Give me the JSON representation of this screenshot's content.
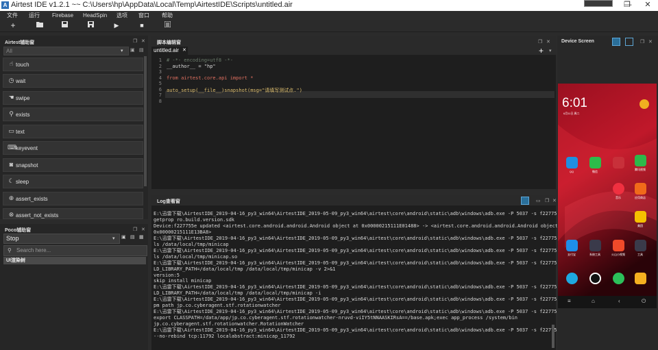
{
  "window": {
    "title": "Airtest IDE v1.2.1 ~~ C:\\Users\\hp\\AppData\\Local\\Temp\\AirtestIDE\\Scripts\\untitled.air",
    "logo": "A",
    "minimize": "—",
    "maximize": "❐",
    "close": "✕"
  },
  "menu": [
    "文件",
    "运行",
    "Firebase",
    "HeadSpin",
    "选项",
    "窗口",
    "帮助"
  ],
  "toolbar": {
    "new": "+",
    "open": "folder-icon",
    "save": "save-icon",
    "save_as": "save-as-icon",
    "run": "▶",
    "stop": "■",
    "report": "report-icon"
  },
  "airtest_panel": {
    "title": "Airtest辅助窗",
    "filter_value": "All",
    "buttons": [
      "touch",
      "wait",
      "swipe",
      "exists",
      "text",
      "keyevent",
      "snapshot",
      "sleep",
      "assert_exists",
      "assert_not_exists"
    ]
  },
  "poco_panel": {
    "title": "Poco辅助窗",
    "mode_value": "Stop",
    "search_placeholder": "Search here...",
    "tree_root": "UI渲染树"
  },
  "editor": {
    "title": "脚本编辑窗",
    "tab_label": "untitled.air",
    "tab_close": "✕",
    "add": "+",
    "line_numbers": [
      "1",
      "2",
      "3",
      "4",
      "5",
      "6",
      "7",
      "8"
    ],
    "lines": [
      "# -*- encoding=utf8 -*-",
      "__author__ = \"hp\"",
      "",
      "from airtest.core.api import *",
      "",
      "auto_setup(__file__)snapshot(msg=\"请填写测试点.\")",
      "",
      ""
    ]
  },
  "log": {
    "title": "Log查看窗",
    "lines": [
      "E:\\迅雷下载\\AirtestIDE_2019-04-16_py3_win64\\AirtestIDE_2019-05-09_py3_win64\\airtest\\core\\android\\static\\adb\\windows\\adb.exe -P 5037 -s f227755e shell",
      "getprop ro.build.version.sdk",
      "Device:f227755e updated <airtest.core.android.android.Android object at 0x00000215111E01488> -> <airtest.core.android.android.Android object at",
      "0x00000215111E13BA8>",
      "E:\\迅雷下载\\AirtestIDE_2019-04-16_py3_win64\\AirtestIDE_2019-05-09_py3_win64\\airtest\\core\\android\\static\\adb\\windows\\adb.exe -P 5037 -s f227755e shell",
      "ls /data/local/tmp/minicap",
      "E:\\迅雷下载\\AirtestIDE_2019-04-16_py3_win64\\AirtestIDE_2019-05-09_py3_win64\\airtest\\core\\android\\static\\adb\\windows\\adb.exe -P 5037 -s f227755e shell",
      "ls /data/local/tmp/minicap.so",
      "E:\\迅雷下载\\AirtestIDE_2019-04-16_py3_win64\\AirtestIDE_2019-05-09_py3_win64\\airtest\\core\\android\\static\\adb\\windows\\adb.exe -P 5037 -s f227755e shell",
      "LD_LIBRARY_PATH=/data/local/tmp /data/local/tmp/minicap -v 2>&1",
      "version:5",
      "skip install minicap",
      "E:\\迅雷下载\\AirtestIDE_2019-04-16_py3_win64\\AirtestIDE_2019-05-09_py3_win64\\airtest\\core\\android\\static\\adb\\windows\\adb.exe -P 5037 -s f227755e shell",
      "LD_LIBRARY_PATH=/data/local/tmp /data/local/tmp/minicap -i",
      "E:\\迅雷下载\\AirtestIDE_2019-04-16_py3_win64\\AirtestIDE_2019-05-09_py3_win64\\airtest\\core\\android\\static\\adb\\windows\\adb.exe -P 5037 -s f227755e shell",
      "pm path jp.co.cyberagent.stf.rotationwatcher",
      "E:\\迅雷下载\\AirtestIDE_2019-04-16_py3_win64\\AirtestIDE_2019-05-09_py3_win64\\airtest\\core\\android\\static\\adb\\windows\\adb.exe -P 5037 -s f227755e shell",
      "export CLASSPATH=/data/app/jp.co.cyberagent.stf.rotationwatcher-nruvd-viIY5tNNAASKIRsA==/base.apk;exec app_process /system/bin",
      "jp.co.cyberagent.stf.rotationwatcher.RotationWatcher",
      "E:\\迅雷下载\\AirtestIDE_2019-04-16_py3_win64\\AirtestIDE_2019-05-09_py3_win64\\airtest\\core\\android\\static\\adb\\windows\\adb.exe -P 5037 -s f227755e forward",
      "--no-rebind tcp:11792 localabstract:minicap_11792"
    ]
  },
  "device": {
    "title": "Device Screen",
    "clock": "6:01",
    "date": "6月11日 周二",
    "apps_row1": [
      "QQ",
      "微信",
      "",
      "",
      "腾讯视频"
    ],
    "apps_row2": [
      "",
      "",
      "",
      "音乐",
      "应用商店"
    ],
    "apps_row3": [
      "",
      "",
      "",
      "",
      "美团"
    ],
    "apps_row4": [
      "支付宝",
      "系统工具",
      "",
      "火山小视频",
      "工具"
    ],
    "dock": [
      "",
      "",
      "",
      ""
    ],
    "colors": {
      "wallpaper_top": "#8a0f1a",
      "wallpaper_bottom": "#1a0206"
    }
  }
}
